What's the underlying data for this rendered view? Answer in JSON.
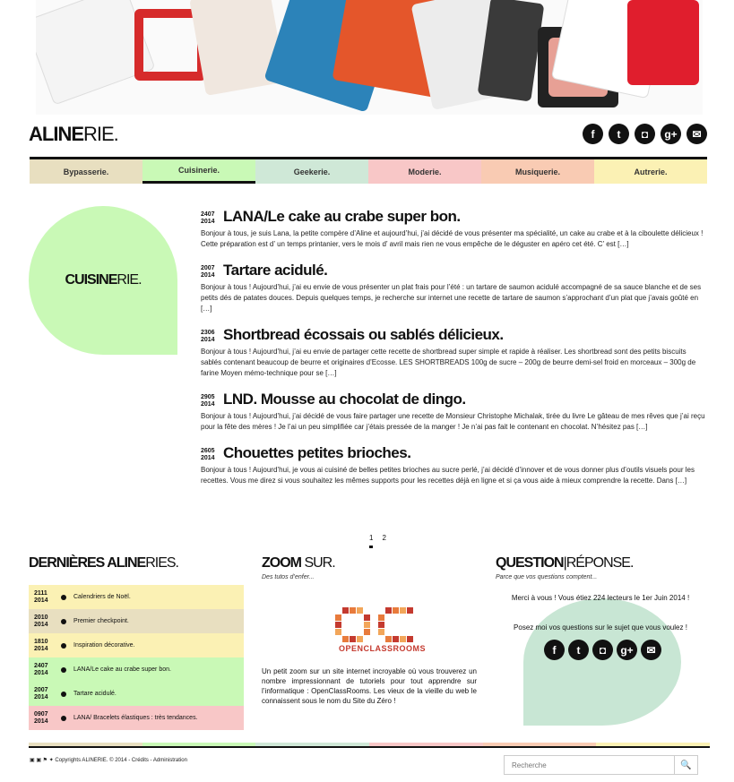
{
  "site": {
    "logo_bold": "ALINE",
    "logo_light": "RIE."
  },
  "social_icons": [
    "facebook-icon",
    "twitter-icon",
    "instagram-icon",
    "google-plus-icon",
    "mail-icon"
  ],
  "nav": {
    "items": [
      {
        "label": "Bypasserie.",
        "color": "#e8dfc0"
      },
      {
        "label": "Cuisinerie.",
        "color": "#c9f9b6"
      },
      {
        "label": "Geekerie.",
        "color": "#cfe8d7"
      },
      {
        "label": "Moderie.",
        "color": "#f8c7c7"
      },
      {
        "label": "Musiquerie.",
        "color": "#f9cbb3"
      },
      {
        "label": "Autrerie.",
        "color": "#fbf1b4"
      }
    ],
    "active_index": 1
  },
  "category": {
    "bold": "CUISINE",
    "light": "RIE."
  },
  "posts": [
    {
      "date_day": "2407",
      "date_year": "2014",
      "title": "LANA/Le cake au crabe super bon.",
      "excerpt": "Bonjour à tous, je suis Lana, la petite compère d’Aline et aujourd’hui, j’ai décidé de vous présenter ma spécialité, un cake au crabe et à la ciboulette délicieux ! Cette préparation est d’ un temps printanier, vers le mois d’ avril mais rien ne vous empêche de le déguster en apéro cet été. C’ est […]"
    },
    {
      "date_day": "2007",
      "date_year": "2014",
      "title": "Tartare acidulé.",
      "excerpt": "Bonjour à tous ! Aujourd’hui, j’ai eu envie de vous présenter un plat frais pour l’été : un tartare de saumon acidulé accompagné de sa sauce blanche et de ses petits dés de patates douces. Depuis quelques temps, je recherche sur internet une recette de tartare de saumon s’approchant d’un plat que j’avais goûté en […]"
    },
    {
      "date_day": "2306",
      "date_year": "2014",
      "title": "Shortbread écossais ou sablés délicieux.",
      "excerpt": "Bonjour à tous ! Aujourd’hui, j’ai eu envie de partager cette recette de shortbread super simple et rapide à réaliser. Les shortbread sont des petits biscuits sablés contenant beaucoup de beurre et originaires d’Ecosse. LES SHORTBREADS 100g de sucre – 200g de beurre demi-sel froid en morceaux – 300g de farine Moyen mémo-technique pour se […]"
    },
    {
      "date_day": "2905",
      "date_year": "2014",
      "title": "LND. Mousse au chocolat de dingo.",
      "excerpt": "Bonjour à tous ! Aujourd’hui, j’ai décidé de vous faire partager une recette de Monsieur Christophe Michalak, tirée du livre Le gâteau de mes rêves que j’ai reçu pour la fête des mères ! Je l’ai un peu simplifiée car j’étais pressée de la manger ! Je n’ai pas fait le contenant en chocolat. N’hésitez pas […]"
    },
    {
      "date_day": "2605",
      "date_year": "2014",
      "title": "Chouettes petites brioches.",
      "excerpt": "Bonjour à tous ! Aujourd’hui, je vous ai cuisiné de belles petites brioches au sucre perlé, j’ai décidé d’innover et de vous donner plus d’outils visuels pour les recettes. Vous me direz si vous souhaitez les mêmes supports pour les recettes déjà en ligne et si ça vous aide à mieux comprendre la recette. Dans […]"
    }
  ],
  "pagination": [
    "1",
    "2"
  ],
  "latest": {
    "title_bold": "DERNIÈRES ALINE",
    "title_light": "RIES.",
    "items": [
      {
        "day": "2111",
        "year": "2014",
        "label": "Calendriers de Noël.",
        "color": "#fbf1b4"
      },
      {
        "day": "2010",
        "year": "2014",
        "label": "Premier checkpoint.",
        "color": "#e8dfc0"
      },
      {
        "day": "1810",
        "year": "2014",
        "label": "Inspiration décorative.",
        "color": "#fbf1b4"
      },
      {
        "day": "2407",
        "year": "2014",
        "label": "LANA/Le cake au crabe super bon.",
        "color": "#c9f9b6"
      },
      {
        "day": "2007",
        "year": "2014",
        "label": "Tartare acidulé.",
        "color": "#c9f9b6"
      },
      {
        "day": "0907",
        "year": "2014",
        "label": "LANA/ Bracelets élastiques : très tendances.",
        "color": "#f8c7c7"
      }
    ]
  },
  "zoom": {
    "title_bold": "ZOOM",
    "title_light": " SUR.",
    "subtitle": "Des tutos d’enfer...",
    "brand": "OPENCLASSROOMS",
    "text": "Un petit zoom sur un site internet incroyable où vous trouverez un nombre impressionnant de tutoriels pour tout apprendre sur l’informatique : OpenClassRooms. Les vieux de la vieille du web le connaissent sous le nom du Site du Zéro !"
  },
  "qa": {
    "title_bold": "QUESTION",
    "title_light": "|RÉPONSE.",
    "subtitle": "Parce que vos questions comptent...",
    "text1": "Merci à vous ! Vous étiez 224 lecteurs le 1er Juin 2014 !",
    "text2": "Posez moi vos questions sur le sujet que vous voulez !"
  },
  "footer": {
    "copyright": "Copyrights ALINERIE. © 2014 - Crédits - Administration",
    "search_placeholder": "Recherche"
  }
}
